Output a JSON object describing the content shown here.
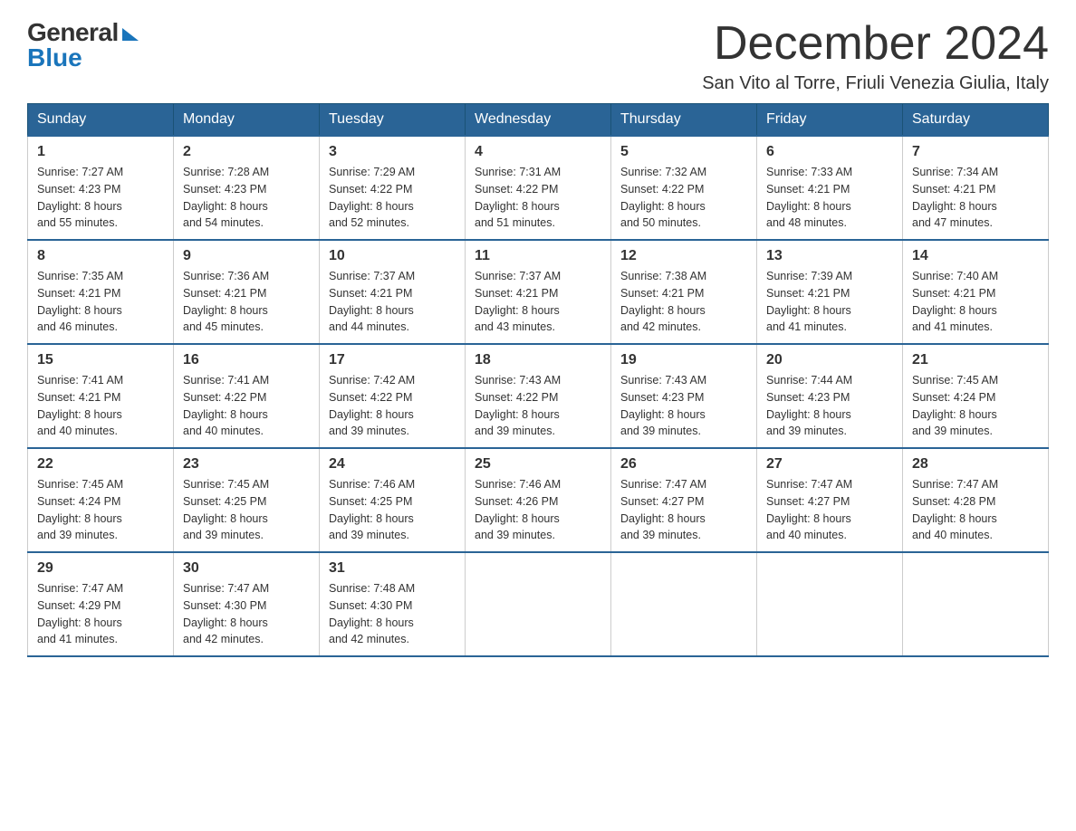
{
  "logo": {
    "general": "General",
    "blue": "Blue"
  },
  "header": {
    "month": "December 2024",
    "location": "San Vito al Torre, Friuli Venezia Giulia, Italy"
  },
  "days_of_week": [
    "Sunday",
    "Monday",
    "Tuesday",
    "Wednesday",
    "Thursday",
    "Friday",
    "Saturday"
  ],
  "weeks": [
    [
      {
        "day": "1",
        "sunrise": "7:27 AM",
        "sunset": "4:23 PM",
        "daylight": "8 hours and 55 minutes."
      },
      {
        "day": "2",
        "sunrise": "7:28 AM",
        "sunset": "4:23 PM",
        "daylight": "8 hours and 54 minutes."
      },
      {
        "day": "3",
        "sunrise": "7:29 AM",
        "sunset": "4:22 PM",
        "daylight": "8 hours and 52 minutes."
      },
      {
        "day": "4",
        "sunrise": "7:31 AM",
        "sunset": "4:22 PM",
        "daylight": "8 hours and 51 minutes."
      },
      {
        "day": "5",
        "sunrise": "7:32 AM",
        "sunset": "4:22 PM",
        "daylight": "8 hours and 50 minutes."
      },
      {
        "day": "6",
        "sunrise": "7:33 AM",
        "sunset": "4:21 PM",
        "daylight": "8 hours and 48 minutes."
      },
      {
        "day": "7",
        "sunrise": "7:34 AM",
        "sunset": "4:21 PM",
        "daylight": "8 hours and 47 minutes."
      }
    ],
    [
      {
        "day": "8",
        "sunrise": "7:35 AM",
        "sunset": "4:21 PM",
        "daylight": "8 hours and 46 minutes."
      },
      {
        "day": "9",
        "sunrise": "7:36 AM",
        "sunset": "4:21 PM",
        "daylight": "8 hours and 45 minutes."
      },
      {
        "day": "10",
        "sunrise": "7:37 AM",
        "sunset": "4:21 PM",
        "daylight": "8 hours and 44 minutes."
      },
      {
        "day": "11",
        "sunrise": "7:37 AM",
        "sunset": "4:21 PM",
        "daylight": "8 hours and 43 minutes."
      },
      {
        "day": "12",
        "sunrise": "7:38 AM",
        "sunset": "4:21 PM",
        "daylight": "8 hours and 42 minutes."
      },
      {
        "day": "13",
        "sunrise": "7:39 AM",
        "sunset": "4:21 PM",
        "daylight": "8 hours and 41 minutes."
      },
      {
        "day": "14",
        "sunrise": "7:40 AM",
        "sunset": "4:21 PM",
        "daylight": "8 hours and 41 minutes."
      }
    ],
    [
      {
        "day": "15",
        "sunrise": "7:41 AM",
        "sunset": "4:21 PM",
        "daylight": "8 hours and 40 minutes."
      },
      {
        "day": "16",
        "sunrise": "7:41 AM",
        "sunset": "4:22 PM",
        "daylight": "8 hours and 40 minutes."
      },
      {
        "day": "17",
        "sunrise": "7:42 AM",
        "sunset": "4:22 PM",
        "daylight": "8 hours and 39 minutes."
      },
      {
        "day": "18",
        "sunrise": "7:43 AM",
        "sunset": "4:22 PM",
        "daylight": "8 hours and 39 minutes."
      },
      {
        "day": "19",
        "sunrise": "7:43 AM",
        "sunset": "4:23 PM",
        "daylight": "8 hours and 39 minutes."
      },
      {
        "day": "20",
        "sunrise": "7:44 AM",
        "sunset": "4:23 PM",
        "daylight": "8 hours and 39 minutes."
      },
      {
        "day": "21",
        "sunrise": "7:45 AM",
        "sunset": "4:24 PM",
        "daylight": "8 hours and 39 minutes."
      }
    ],
    [
      {
        "day": "22",
        "sunrise": "7:45 AM",
        "sunset": "4:24 PM",
        "daylight": "8 hours and 39 minutes."
      },
      {
        "day": "23",
        "sunrise": "7:45 AM",
        "sunset": "4:25 PM",
        "daylight": "8 hours and 39 minutes."
      },
      {
        "day": "24",
        "sunrise": "7:46 AM",
        "sunset": "4:25 PM",
        "daylight": "8 hours and 39 minutes."
      },
      {
        "day": "25",
        "sunrise": "7:46 AM",
        "sunset": "4:26 PM",
        "daylight": "8 hours and 39 minutes."
      },
      {
        "day": "26",
        "sunrise": "7:47 AM",
        "sunset": "4:27 PM",
        "daylight": "8 hours and 39 minutes."
      },
      {
        "day": "27",
        "sunrise": "7:47 AM",
        "sunset": "4:27 PM",
        "daylight": "8 hours and 40 minutes."
      },
      {
        "day": "28",
        "sunrise": "7:47 AM",
        "sunset": "4:28 PM",
        "daylight": "8 hours and 40 minutes."
      }
    ],
    [
      {
        "day": "29",
        "sunrise": "7:47 AM",
        "sunset": "4:29 PM",
        "daylight": "8 hours and 41 minutes."
      },
      {
        "day": "30",
        "sunrise": "7:47 AM",
        "sunset": "4:30 PM",
        "daylight": "8 hours and 42 minutes."
      },
      {
        "day": "31",
        "sunrise": "7:48 AM",
        "sunset": "4:30 PM",
        "daylight": "8 hours and 42 minutes."
      },
      null,
      null,
      null,
      null
    ]
  ]
}
